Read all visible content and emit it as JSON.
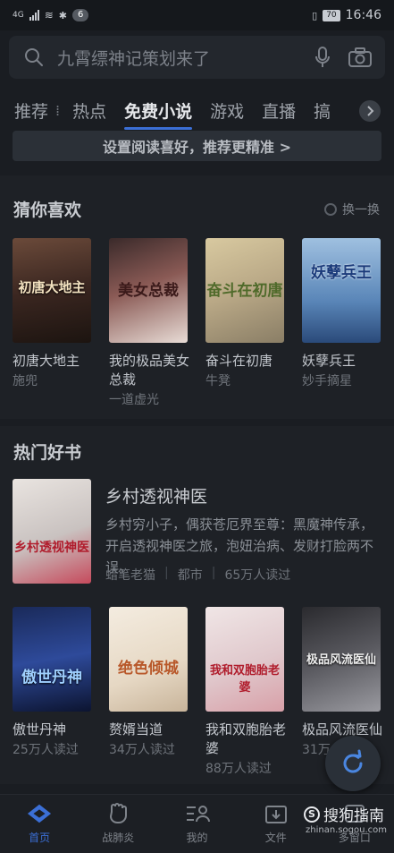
{
  "status_bar": {
    "network": "4G",
    "notif_count": "6",
    "battery": "70",
    "time": "16:46"
  },
  "search": {
    "placeholder": "九霄缥神记策划来了"
  },
  "tabs": [
    {
      "label": "推荐"
    },
    {
      "label": "热点"
    },
    {
      "label": "免费小说",
      "active": true
    },
    {
      "label": "游戏"
    },
    {
      "label": "直播"
    },
    {
      "label": "搞"
    }
  ],
  "pref_banner": {
    "label": "设置阅读喜好，推荐更精准 >"
  },
  "guess_section": {
    "title": "猜你喜欢",
    "refresh_label": "换一换",
    "books": [
      {
        "title": "初唐大地主",
        "meta": "施兜",
        "cover_text": "初唐大地主"
      },
      {
        "title": "我的极品美女总裁",
        "meta": "一道虚光",
        "cover_text": "美女总裁"
      },
      {
        "title": "奋斗在初唐",
        "meta": "牛凳",
        "cover_text": "奋斗在初唐"
      },
      {
        "title": "妖孽兵王",
        "meta": "妙手摘星",
        "cover_text": "妖孽兵王"
      }
    ]
  },
  "hot_section": {
    "title": "热门好书",
    "feature": {
      "title": "乡村透视神医",
      "desc": "乡村穷小子，偶获苍厄界至尊：黑魔神传承，开启透视神医之旅，泡妞治病、发财打脸两不误。",
      "author": "蜡笔老猫",
      "category": "都市",
      "readers": "65万人读过",
      "cover_text": "乡村透视神医"
    },
    "books": [
      {
        "title": "傲世丹神",
        "meta": "25万人读过",
        "cover_text": "傲世丹神"
      },
      {
        "title": "赘婿当道",
        "meta": "34万人读过",
        "cover_text": "绝色倾城"
      },
      {
        "title": "我和双胞胎老婆",
        "meta": "88万人读过",
        "cover_text": "我和双胞胎老婆"
      },
      {
        "title": "极品风流医仙",
        "meta": "31万",
        "cover_text": "极品风流医仙"
      }
    ]
  },
  "bottom_nav": [
    {
      "label": "首页",
      "icon": "home-icon",
      "active": true
    },
    {
      "label": "战肺炎",
      "icon": "fist-icon"
    },
    {
      "label": "我的",
      "icon": "user-icon"
    },
    {
      "label": "文件",
      "icon": "download-icon"
    },
    {
      "label": "多窗口",
      "icon": "windows-icon"
    }
  ],
  "watermark": {
    "main": "搜狗指南",
    "logo_letter": "S",
    "url": "zhinan.sogou.com"
  },
  "colors": {
    "accent": "#3b6fd6",
    "background": "#1a1d22"
  }
}
